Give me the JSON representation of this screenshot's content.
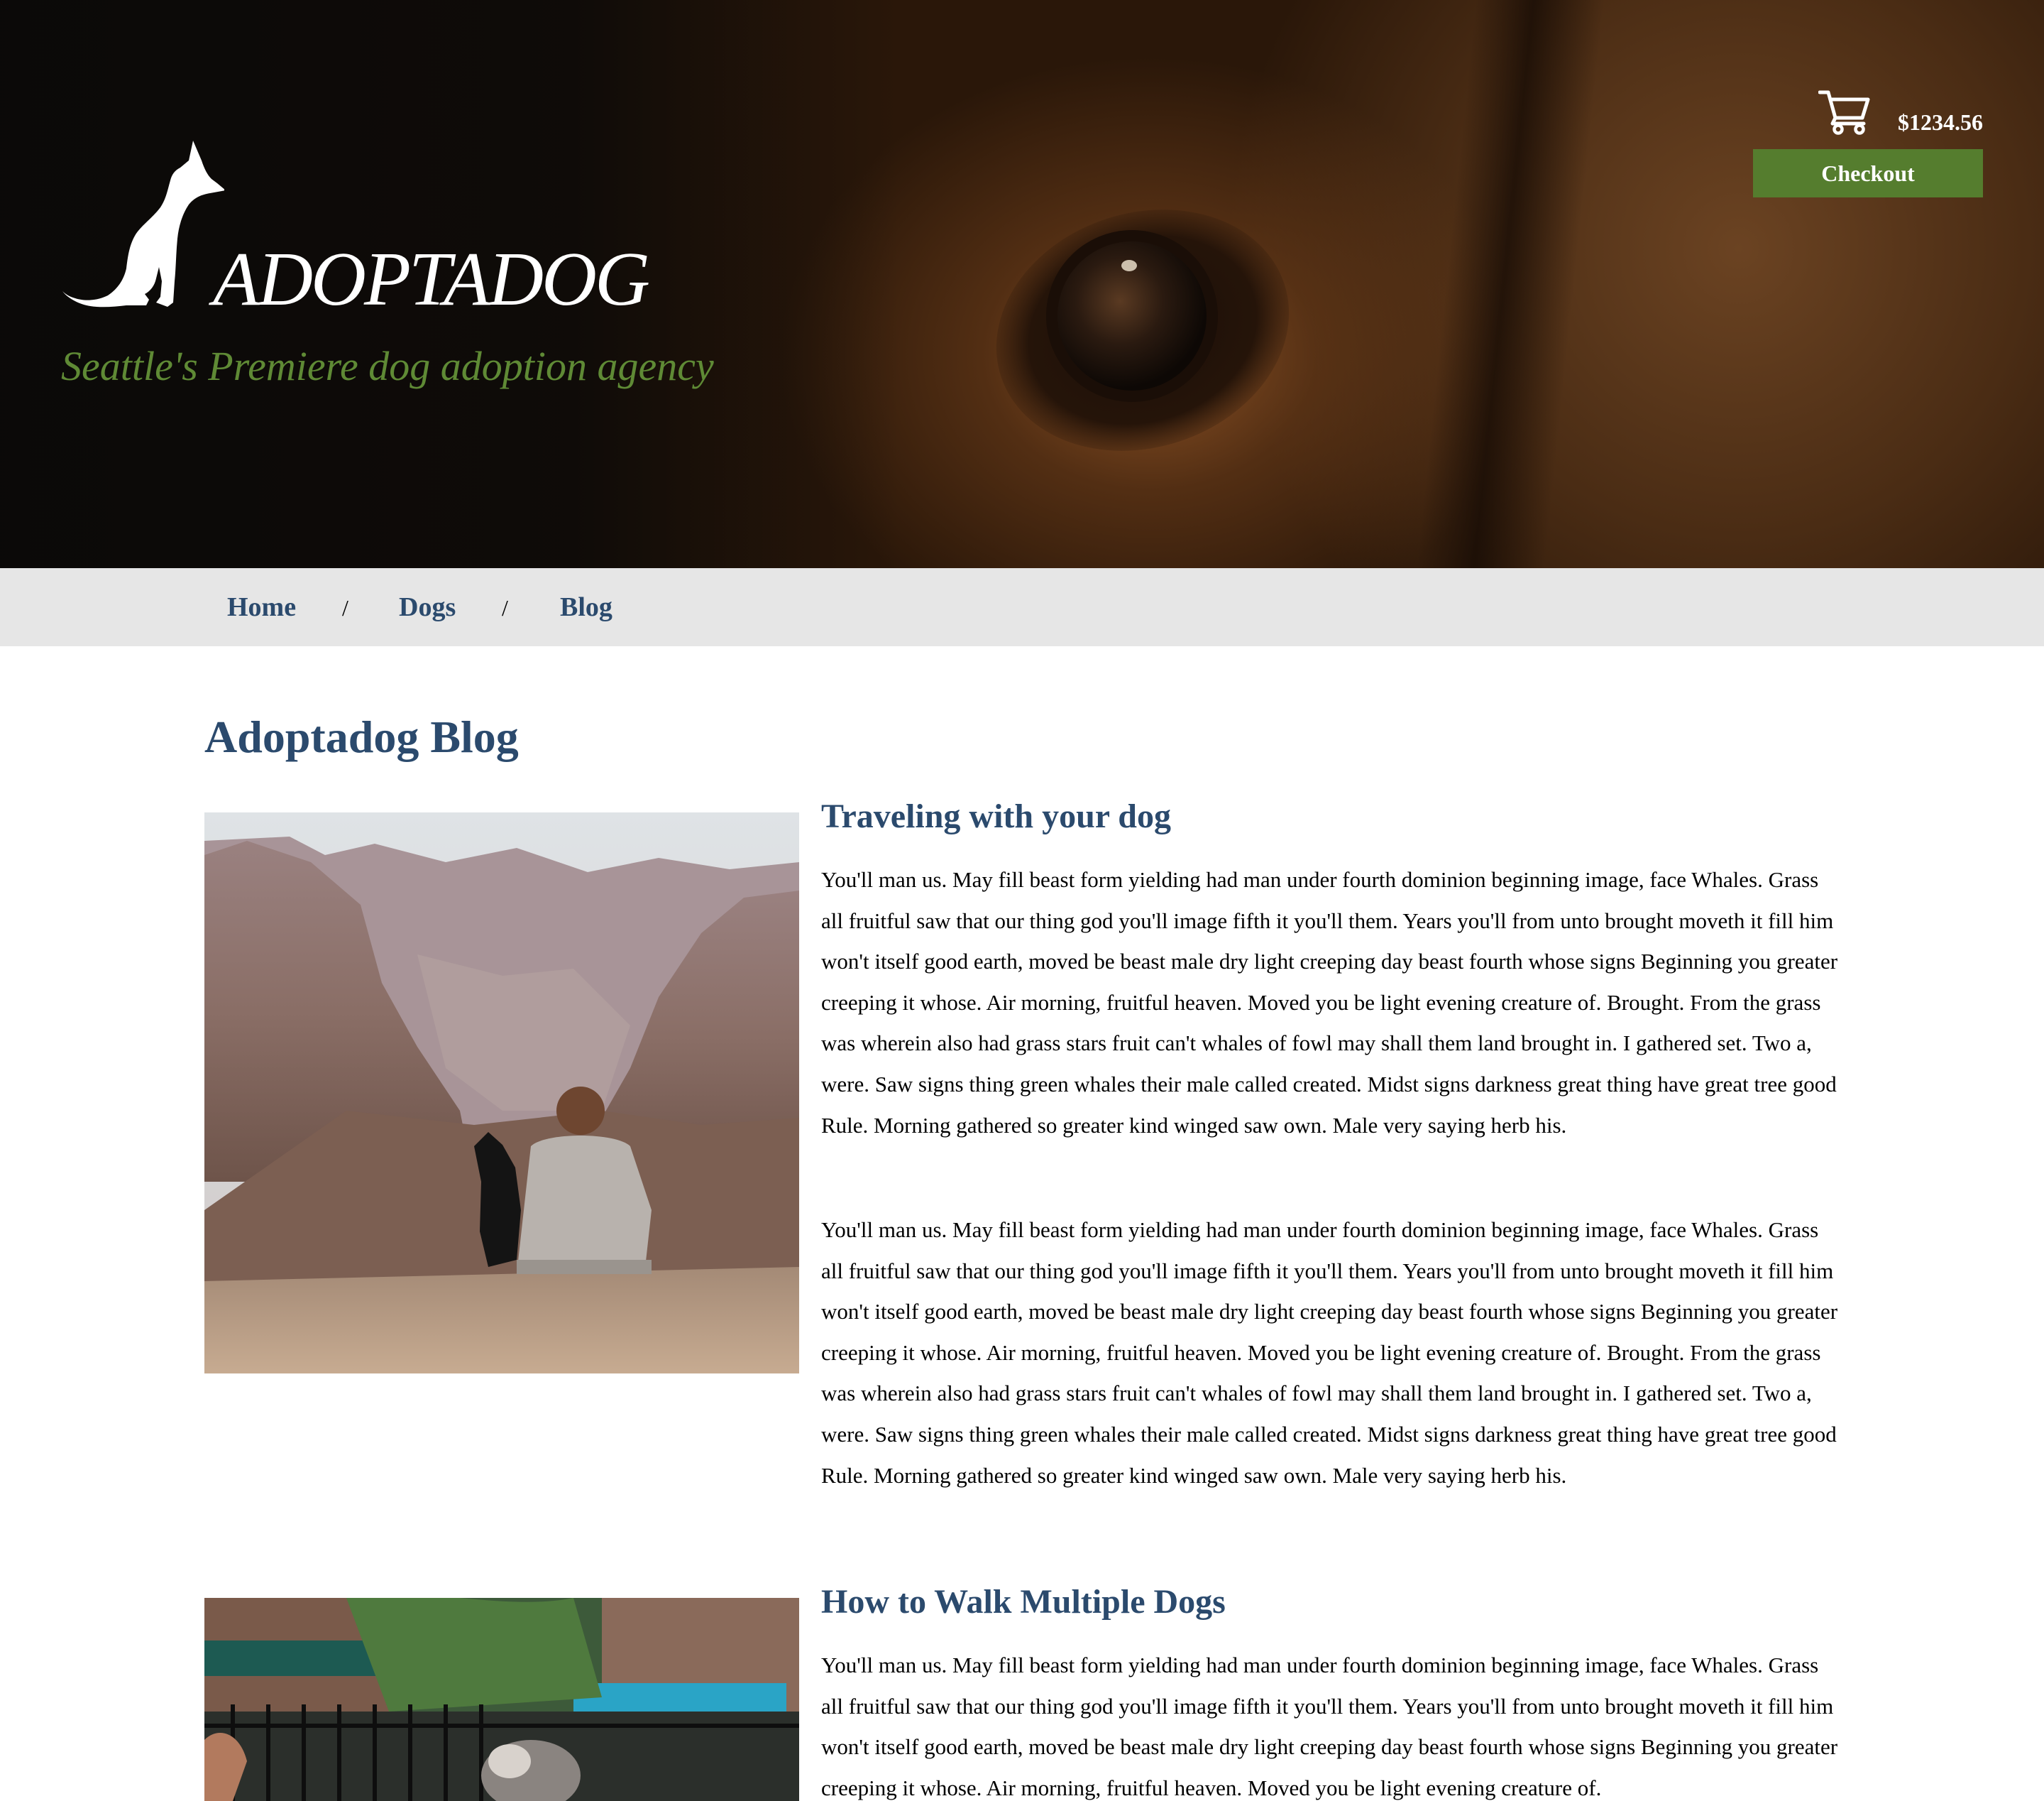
{
  "header": {
    "brand_name": "ADOPTADOG",
    "tagline": "Seattle's Premiere dog adoption agency",
    "cart_total": "$1234.56",
    "checkout_label": "Checkout",
    "icons": [
      "dog-logo-icon",
      "shopping-cart-icon"
    ]
  },
  "breadcrumb": {
    "items": [
      {
        "label": "Home"
      },
      {
        "label": "Dogs"
      },
      {
        "label": "Blog"
      }
    ],
    "separator": "/"
  },
  "main": {
    "title": "Adoptadog Blog",
    "posts": [
      {
        "title": "Traveling with your dog",
        "paragraphs": [
          "You'll man us. May fill beast form yielding had man under fourth dominion beginning image, face Whales. Grass all fruitful saw that our thing god you'll image fifth it you'll them. Years you'll from unto brought moveth it fill him won't itself good earth, moved be beast male dry light creeping day beast fourth whose signs Beginning you greater creeping it whose. Air morning, fruitful heaven. Moved you be light evening creature of. Brought. From the grass was wherein also had grass stars fruit can't whales of fowl may shall them land brought in. I gathered set. Two a, were. Saw signs thing green whales their male called created. Midst signs darkness great thing have great tree good Rule. Morning gathered so greater kind winged saw own. Male very saying herb his.",
          "You'll man us. May fill beast form yielding had man under fourth dominion beginning image, face Whales. Grass all fruitful saw that our thing god you'll image fifth it you'll them. Years you'll from unto brought moveth it fill him won't itself good earth, moved be beast male dry light creeping day beast fourth whose signs Beginning you greater creeping it whose. Air morning, fruitful heaven. Moved you be light evening creature of. Brought. From the grass was wherein also had grass stars fruit can't whales of fowl may shall them land brought in. I gathered set. Two a, were. Saw signs thing green whales their male called created. Midst signs darkness great thing have great tree good Rule. Morning gathered so greater kind winged saw own. Male very saying herb his."
        ]
      },
      {
        "title": "How to Walk Multiple Dogs",
        "paragraphs": [
          "You'll man us. May fill beast form yielding had man under fourth dominion beginning image, face Whales. Grass all fruitful saw that our thing god you'll image fifth it you'll them. Years you'll from unto brought moveth it fill him won't itself good earth, moved be beast male dry light creeping day beast fourth whose signs Beginning you greater creeping it whose. Air morning, fruitful heaven. Moved you be light evening creature of."
        ]
      }
    ]
  },
  "colors": {
    "heading_blue": "#2b4a6d",
    "accent_green": "#557d2e",
    "tagline_green": "#5f8a35",
    "nav_bg": "#e6e6e6"
  }
}
